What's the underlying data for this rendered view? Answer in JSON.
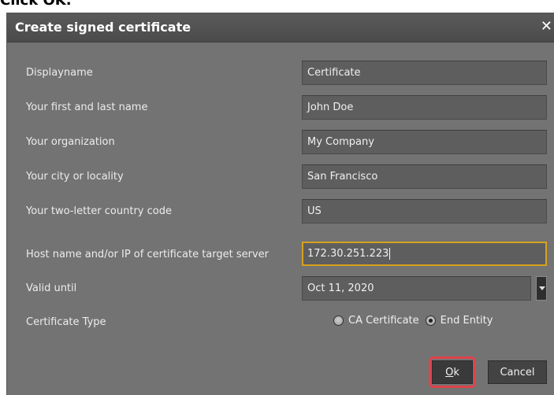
{
  "instruction": "Click OK.",
  "dialog": {
    "title": "Create signed certificate",
    "close_glyph": "✕",
    "fields": [
      {
        "label": "Displayname",
        "value": "Certificate"
      },
      {
        "label": "Your first and last name",
        "value": "John Doe"
      },
      {
        "label": "Your organization",
        "value": "My Company"
      },
      {
        "label": "Your city or locality",
        "value": "San Francisco"
      },
      {
        "label": "Your two-letter country code",
        "value": "US"
      },
      {
        "label": "Host name and/or IP of certificate target server",
        "value": "172.30.251.223"
      }
    ],
    "valid_until": {
      "label": "Valid until",
      "value": "Oct 11, 2020"
    },
    "certificate_type": {
      "label": "Certificate Type",
      "options": [
        "CA Certificate",
        "End Entity"
      ],
      "selected": "End Entity"
    },
    "buttons": {
      "ok_underlined": "O",
      "ok_rest": "k",
      "cancel": "Cancel"
    }
  },
  "colors": {
    "dialog_bg": "#737373",
    "focus_border": "#d6a21e",
    "highlight": "#e0434b"
  }
}
